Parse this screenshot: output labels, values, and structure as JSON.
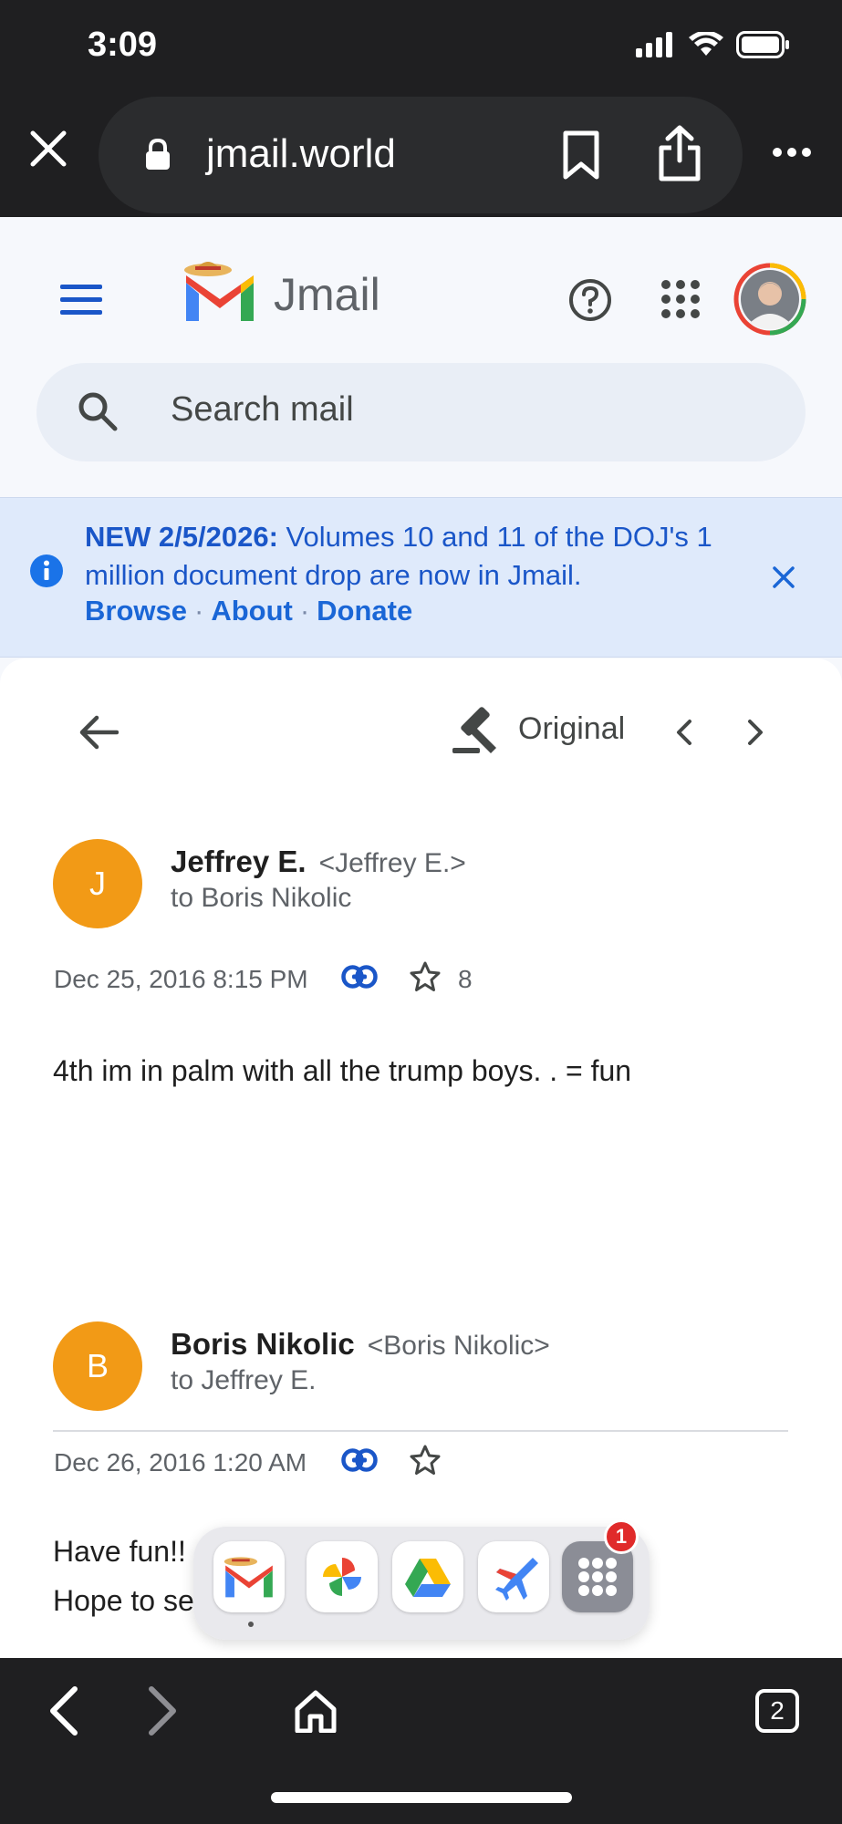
{
  "status_bar": {
    "time": "3:09",
    "icons": [
      "signal-icon",
      "wifi-icon",
      "battery-icon"
    ]
  },
  "browser": {
    "url": "jmail.world",
    "icons": [
      "close-icon",
      "lock-icon",
      "bookmark-icon",
      "share-icon",
      "more-icon"
    ],
    "tab_count": "2"
  },
  "app": {
    "name": "Jmail",
    "search_placeholder": "Search mail",
    "header_icons": [
      "menu-icon",
      "help-icon",
      "apps-grid-icon",
      "avatar"
    ]
  },
  "banner": {
    "bold": "NEW 2/5/2026:",
    "text": " Volumes 10 and 11 of the DOJ's 1 million document drop are now in Jmail.",
    "links": [
      "Browse",
      "About",
      "Donate"
    ],
    "separator": "·"
  },
  "toolbar": {
    "original_label": "Original"
  },
  "messages": [
    {
      "avatar_letter": "J",
      "sender": "Jeffrey E.",
      "email": "<Jeffrey E.>",
      "to": "to Boris Nikolic",
      "date": "Dec 25, 2016 8:15 PM",
      "star_count": "8",
      "body": [
        "4th im in palm with all the trump boys. . = fun"
      ]
    },
    {
      "avatar_letter": "B",
      "sender": "Boris Nikolic",
      "email": "<Boris Nikolic>",
      "to": "to Jeffrey E.",
      "date": "Dec 26, 2016 1:20 AM",
      "star_count": "",
      "body": [
        "Have fun!!",
        "Hope to se"
      ]
    }
  ],
  "dock": {
    "apps": [
      "gmail-app",
      "photos-app",
      "drive-app",
      "flights-app",
      "more-apps"
    ],
    "badge": "1"
  },
  "colors": {
    "accent": "#1a66d6",
    "avatar": "#f29a16",
    "dark": "#1f1f21"
  }
}
